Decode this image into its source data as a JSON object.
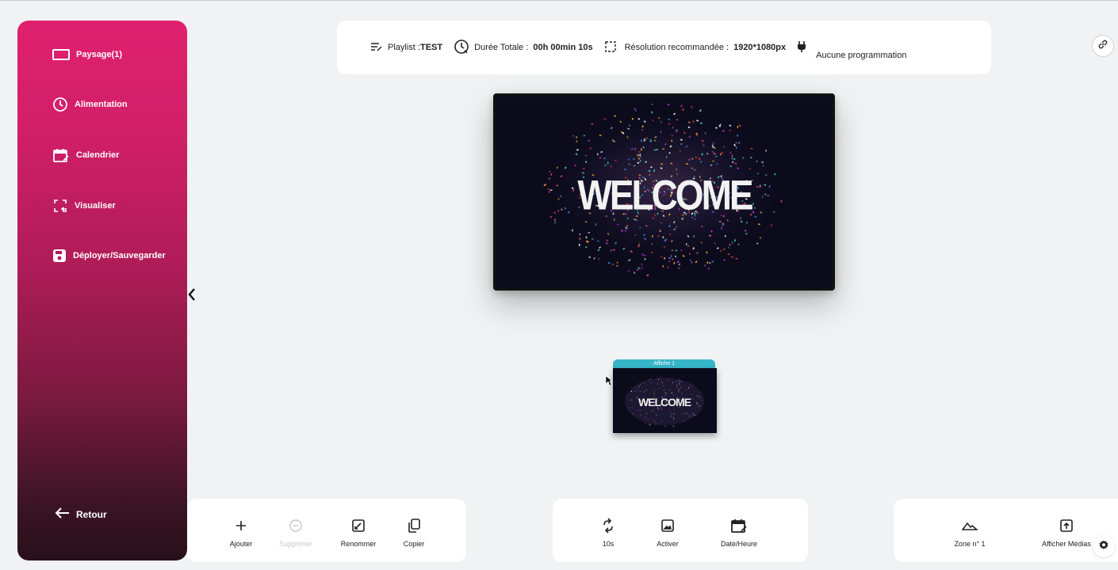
{
  "sidebar": {
    "items": [
      {
        "label": "Paysage(1)",
        "icon": "screen-landscape-icon"
      },
      {
        "label": "Alimentation",
        "icon": "clock-icon"
      },
      {
        "label": "Calendrier",
        "icon": "calendar-icon"
      },
      {
        "label": "Visualiser",
        "icon": "fullscreen-icon"
      },
      {
        "label": "Déployer/Sauvegarder",
        "icon": "save-icon"
      }
    ],
    "back_label": "Retour",
    "gradient_top": "#e0206e",
    "gradient_bottom": "#28101a"
  },
  "infobar": {
    "playlist_label": "Playlist :",
    "playlist_name": "TEST",
    "duration_label": "Durée Totale :",
    "duration_value": "00h 00min 10s",
    "resolution_label": "Résolution recommandée :",
    "resolution_value": "1920*1080px",
    "schedule_text": "Aucune programmation"
  },
  "preview": {
    "text": "WELCOME"
  },
  "thumbnail": {
    "tab_label": "Affiche 1",
    "text": "WELCOME",
    "tab_color": "#37b6c9"
  },
  "toolbar_left": {
    "add": "Ajouter",
    "delete": "Supprimer",
    "rename": "Renommer",
    "copy": "Copier"
  },
  "toolbar_mid": {
    "duration": "10s",
    "activate": "Activer",
    "datetime": "Date/Heure"
  },
  "toolbar_right": {
    "zone": "Zone n° 1",
    "show_media": "Afficher Médias"
  }
}
